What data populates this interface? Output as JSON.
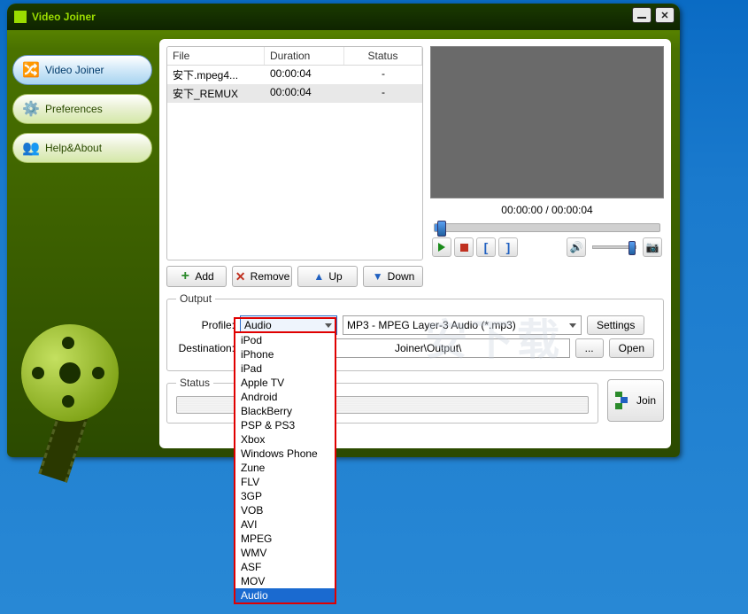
{
  "window": {
    "title": "Video Joiner"
  },
  "sidebar": {
    "items": [
      {
        "label": "Video Joiner",
        "icon": "merge"
      },
      {
        "label": "Preferences",
        "icon": "gear"
      },
      {
        "label": "Help&About",
        "icon": "people"
      }
    ]
  },
  "table": {
    "headers": {
      "file": "File",
      "duration": "Duration",
      "status": "Status"
    },
    "rows": [
      {
        "file": "安下.mpeg4...",
        "duration": "00:00:04",
        "status": "-"
      },
      {
        "file": "安下_REMUX",
        "duration": "00:00:04",
        "status": "-"
      }
    ]
  },
  "file_actions": {
    "add": "Add",
    "remove": "Remove",
    "up": "Up",
    "down": "Down"
  },
  "preview": {
    "time": "00:00:00 / 00:00:04"
  },
  "output": {
    "title": "Output",
    "profile_label": "Profile:",
    "profile_value": "Audio",
    "codec_value": "MP3 - MPEG Layer-3 Audio (*.mp3)",
    "settings": "Settings",
    "dest_label": "Destination:",
    "dest_value": "Joiner\\Output\\",
    "browse": "...",
    "open": "Open"
  },
  "status": {
    "title": "Status"
  },
  "join": {
    "label": "Join"
  },
  "dropdown": {
    "items": [
      "iPod",
      "iPhone",
      "iPad",
      "Apple TV",
      "Android",
      "BlackBerry",
      "PSP & PS3",
      "Xbox",
      "Windows Phone",
      "Zune",
      "FLV",
      "3GP",
      "VOB",
      "AVI",
      "MPEG",
      "WMV",
      "ASF",
      "MOV",
      "Audio"
    ],
    "selected": "Audio"
  },
  "watermark": "安下载"
}
